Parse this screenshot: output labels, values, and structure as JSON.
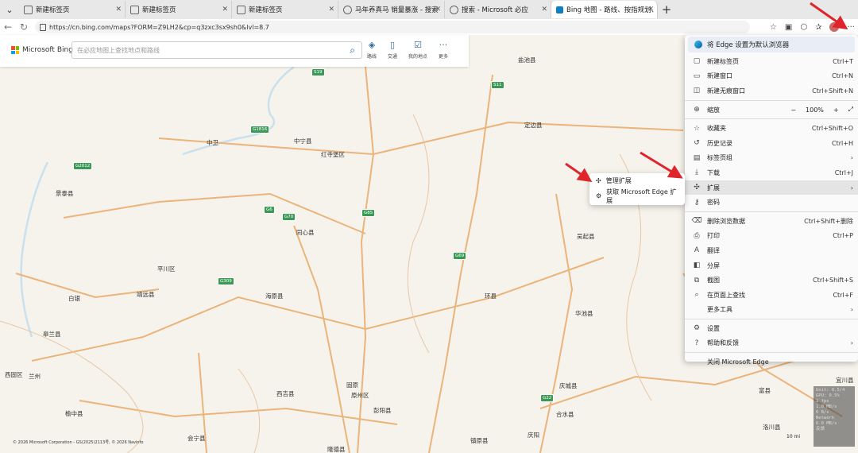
{
  "tabs": [
    {
      "label": "新建标签页",
      "active": false
    },
    {
      "label": "新建标签页",
      "active": false
    },
    {
      "label": "新建标签页",
      "active": false
    },
    {
      "label": "马年养真马 销量暴涨 - 搜索",
      "active": false
    },
    {
      "label": "搜索 - Microsoft 必应",
      "active": false
    },
    {
      "label": "Bing 地图 - 路线、按指规划、交通",
      "active": true
    }
  ],
  "address": {
    "url": "https://cn.bing.com/maps?FORM=Z9LH2&cp=q3zxc3sx9sh0&lvl=8.7"
  },
  "bing": {
    "logo": "Microsoft Bing",
    "search_placeholder": "在必应地图上查找地点和路线",
    "tools": [
      {
        "label": "路线",
        "icon": "directions-icon"
      },
      {
        "label": "交通",
        "icon": "traffic-icon"
      },
      {
        "label": "我的地点",
        "icon": "my-places-icon"
      },
      {
        "label": "更多",
        "icon": "more-icon"
      }
    ]
  },
  "menu": {
    "default_banner": "将 Edge 设置为默认浏览器",
    "items": [
      {
        "label": "新建标签页",
        "shortcut": "Ctrl+T",
        "icon": "new-tab-icon"
      },
      {
        "label": "新建窗口",
        "shortcut": "Ctrl+N",
        "icon": "new-window-icon"
      },
      {
        "label": "新建无痕窗口",
        "shortcut": "Ctrl+Shift+N",
        "icon": "inprivate-icon"
      },
      {
        "label": "缩放",
        "shortcut": "",
        "icon": "zoom-icon"
      },
      {
        "label": "收藏夹",
        "shortcut": "Ctrl+Shift+O",
        "icon": "favorites-icon"
      },
      {
        "label": "历史记录",
        "shortcut": "Ctrl+H",
        "icon": "history-icon"
      },
      {
        "label": "标签页组",
        "shortcut": "",
        "icon": "tab-groups-icon"
      },
      {
        "label": "下载",
        "shortcut": "Ctrl+J",
        "icon": "download-icon"
      },
      {
        "label": "扩展",
        "shortcut": "",
        "icon": "extensions-icon"
      },
      {
        "label": "密码",
        "shortcut": "",
        "icon": "key-icon"
      },
      {
        "label": "删除浏览数据",
        "shortcut": "Ctrl+Shift+删除",
        "icon": "trash-icon"
      },
      {
        "label": "打印",
        "shortcut": "Ctrl+P",
        "icon": "print-icon"
      },
      {
        "label": "翻译",
        "shortcut": "",
        "icon": "translate-icon"
      },
      {
        "label": "分屏",
        "shortcut": "",
        "icon": "split-screen-icon"
      },
      {
        "label": "截图",
        "shortcut": "Ctrl+Shift+S",
        "icon": "screenshot-icon"
      },
      {
        "label": "在页面上查找",
        "shortcut": "Ctrl+F",
        "icon": "find-icon"
      },
      {
        "label": "更多工具",
        "shortcut": "",
        "icon": "more-tools-icon"
      },
      {
        "label": "设置",
        "shortcut": "",
        "icon": "settings-icon"
      },
      {
        "label": "帮助和反馈",
        "shortcut": "",
        "icon": "help-icon"
      },
      {
        "label": "关闭 Microsoft Edge",
        "shortcut": "",
        "icon": ""
      }
    ],
    "zoom_value": "100%",
    "zoom_minus": "−",
    "zoom_plus": "+"
  },
  "submenu": {
    "items": [
      {
        "label": "管理扩展",
        "icon": "puzzle-icon"
      },
      {
        "label": "获取 Microsoft Edge 扩展",
        "icon": "store-icon"
      }
    ]
  },
  "map_labels": [
    "盐池县",
    "定边县",
    "中卫",
    "中宁县",
    "红寺堡区",
    "景泰县",
    "同心县",
    "吴起县",
    "平川区",
    "白银",
    "靖远县",
    "海原县",
    "环县",
    "华池县",
    "皋兰县",
    "兰州",
    "庆城县",
    "西吉县",
    "固原",
    "原州区",
    "彭阳县",
    "合水县",
    "宜川县",
    "榆中县",
    "会宁县",
    "庆阳",
    "镇原县",
    "洛川县",
    "隆德县",
    "富县",
    "西固区"
  ],
  "road_badges": [
    "G6",
    "G70",
    "G2012",
    "G85",
    "G69",
    "G22",
    "S19",
    "S11",
    "G1816",
    "G309"
  ],
  "copyright": "© 2026 Microsoft Corporation - GS(2025)2113号, © 2026 Navinfo",
  "scale_label": "10 mi",
  "fps_overlay": [
    "Unit: 0.5/4",
    "GPU: 0.5%",
    "1 fps",
    "1.0 MB/s",
    "0 B/s",
    "Network",
    "6.0 MB/s",
    "反馈"
  ],
  "colors": {
    "accent": "#0f7dc2",
    "road": "#e9a35a",
    "menu_bg": "#fafafa",
    "highlight": "#e4e4e4",
    "arrow": "#e0242b"
  }
}
